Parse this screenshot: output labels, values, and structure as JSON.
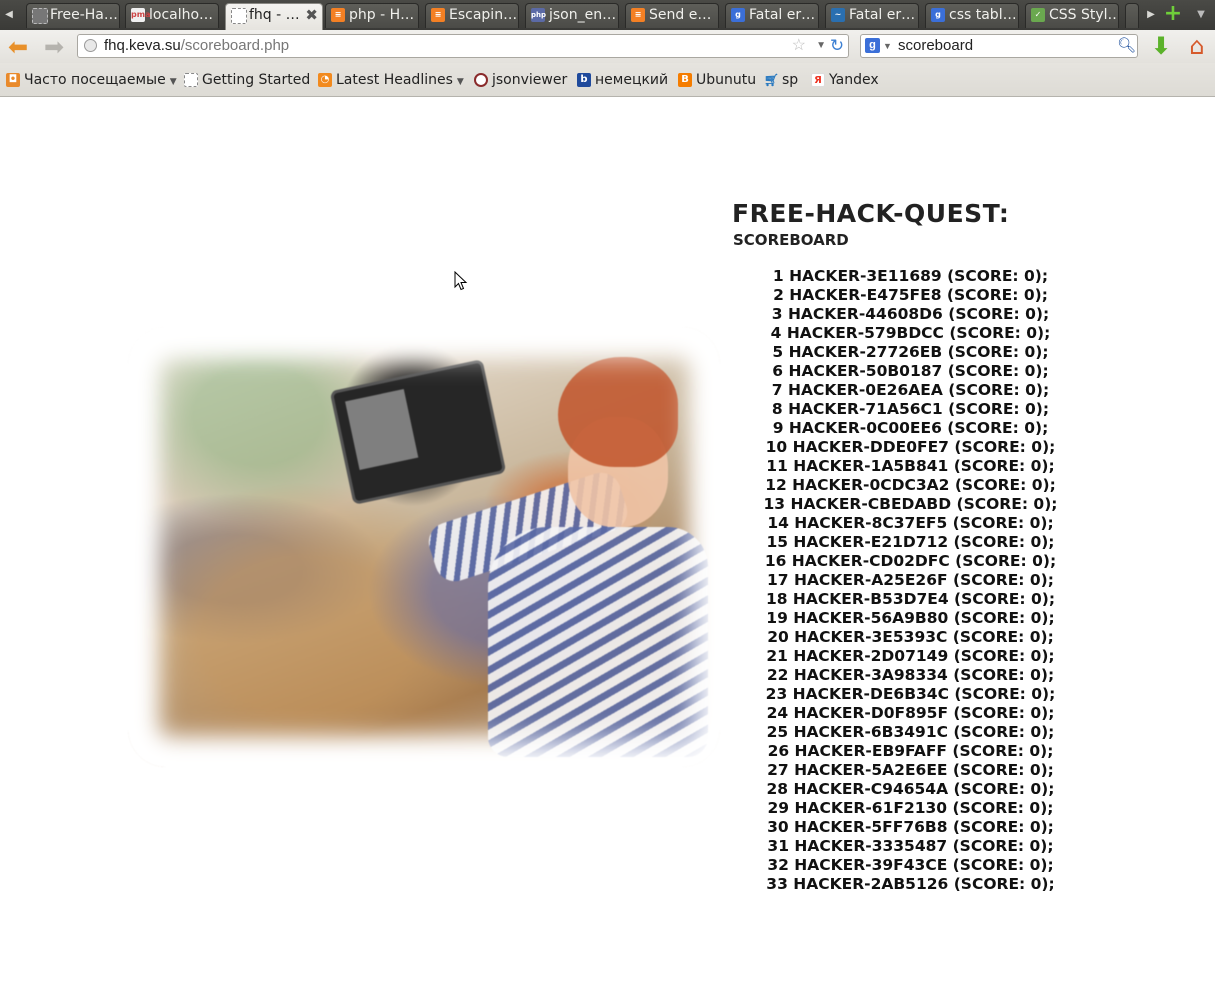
{
  "browser": {
    "tabs": [
      {
        "label": "Free-Ha…",
        "icon": "page-icon",
        "active": false
      },
      {
        "label": "localho…",
        "icon": "pma-icon",
        "active": false
      },
      {
        "label": "fhq - …",
        "icon": "page-icon",
        "active": true
      },
      {
        "label": "php - H…",
        "icon": "stackoverflow-icon",
        "active": false
      },
      {
        "label": "Escapin…",
        "icon": "stackoverflow-icon",
        "active": false
      },
      {
        "label": "json_en…",
        "icon": "php-icon",
        "active": false
      },
      {
        "label": "Send e…",
        "icon": "stackoverflow-icon",
        "active": false
      },
      {
        "label": "Fatal er…",
        "icon": "google-icon",
        "active": false
      },
      {
        "label": "Fatal er…",
        "icon": "bird-icon",
        "active": false
      },
      {
        "label": "css tabl…",
        "icon": "google-icon",
        "active": false
      },
      {
        "label": "CSS Styl…",
        "icon": "w3-icon",
        "active": false
      }
    ],
    "url": {
      "host": "fhq.keva.su",
      "path": "/scoreboard.php"
    },
    "search": {
      "engine_letter": "g",
      "value": "scoreboard"
    },
    "bookmarks": [
      {
        "label": "Часто посещаемые",
        "icon": "rss-folder-icon",
        "dropdown": true
      },
      {
        "label": "Getting Started",
        "icon": "page-icon",
        "dropdown": false
      },
      {
        "label": "Latest Headlines",
        "icon": "rss-icon",
        "dropdown": true
      },
      {
        "label": "jsonviewer",
        "icon": "jsonviewer-icon",
        "dropdown": false
      },
      {
        "label": "немецкий",
        "icon": "b-icon",
        "dropdown": false
      },
      {
        "label": "Ubunutu",
        "icon": "blogger-icon",
        "dropdown": false
      },
      {
        "label": "sp",
        "icon": "cart-icon",
        "dropdown": false
      },
      {
        "label": "Yandex",
        "icon": "yandex-icon",
        "dropdown": false
      }
    ]
  },
  "page": {
    "title": "Free-Hack-Quest:",
    "subtitle": "Scoreboard",
    "photo_alt": "hacker photo",
    "scores": [
      "1 hacker-3e11689 (score: 0);",
      "2 hacker-e475fe8 (score: 0);",
      "3 hacker-44608d6 (score: 0);",
      "4 hacker-579bdcc (score: 0);",
      "5 hacker-27726eb (score: 0);",
      "6 hacker-50b0187 (score: 0);",
      "7 hacker-0e26aea (score: 0);",
      "8 hacker-71a56c1 (score: 0);",
      "9 hacker-0c00ee6 (score: 0);",
      "10 hacker-dde0fe7 (score: 0);",
      "11 hacker-1a5b841 (score: 0);",
      "12 hacker-0cdc3a2 (score: 0);",
      "13 hacker-cbedabd (score: 0);",
      "14 hacker-8c37ef5 (score: 0);",
      "15 hacker-e21d712 (score: 0);",
      "16 hacker-cd02dfc (score: 0);",
      "17 hacker-a25e26f (score: 0);",
      "18 hacker-b53d7e4 (score: 0);",
      "19 hacker-56a9b80 (score: 0);",
      "20 hacker-3e5393c (score: 0);",
      "21 hacker-2d07149 (score: 0);",
      "22 hacker-3a98334 (score: 0);",
      "23 hacker-de6b34c (score: 0);",
      "24 hacker-d0f895f (score: 0);",
      "25 hacker-6b3491c (score: 0);",
      "26 hacker-eb9faff (score: 0);",
      "27 hacker-5a2e6ee (score: 0);",
      "28 hacker-c94654a (score: 0);",
      "29 hacker-61f2130 (score: 0);",
      "30 hacker-5ff76b8 (score: 0);",
      "31 hacker-3335487 (score: 0);",
      "32 hacker-39f43ce (score: 0);",
      "33 hacker-2ab5126 (score: 0);"
    ]
  },
  "colors": {
    "tab_bg": "#4b4b47",
    "active_tab_bg": "#efeeeb",
    "back_arrow": "#e8902a",
    "reload": "#3b7fd2",
    "download": "#5bb22a",
    "home": "#d65a2c"
  }
}
